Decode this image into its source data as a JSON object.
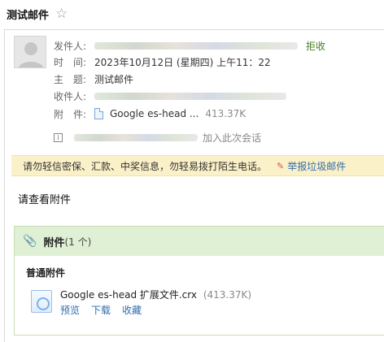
{
  "header": {
    "subject": "测试邮件"
  },
  "meta": {
    "from_label": "发件人:",
    "reject_label": "拒收",
    "time_label": "时　间:",
    "time_value": "2023年10月12日 (星期四) 上午11：22",
    "subject_label": "主　题:",
    "subject_value": "测试邮件",
    "to_label": "收件人:",
    "attachment_label": "附　件:",
    "attachment_name": "Google es-head ...",
    "attachment_size": "413.37K",
    "add_contact": "加入此次会话"
  },
  "warning": {
    "text": "请勿轻信密保、汇款、中奖信息，勿轻易拨打陌生电话。",
    "report_link": "举报垃圾邮件"
  },
  "body": {
    "text": "请查看附件"
  },
  "attachments": {
    "title": "附件",
    "count": "(1 个)",
    "group_label": "普通附件",
    "items": [
      {
        "name": "Google es-head 扩展文件.crx",
        "size": "(413.37K)",
        "actions": [
          "预览",
          "下载",
          "收藏"
        ]
      }
    ]
  },
  "colors": {
    "warning_bg": "#fbf1c8",
    "attachment_header_bg": "#dff0d5",
    "link_blue": "#2f6db1",
    "link_green": "#3f7f22"
  }
}
